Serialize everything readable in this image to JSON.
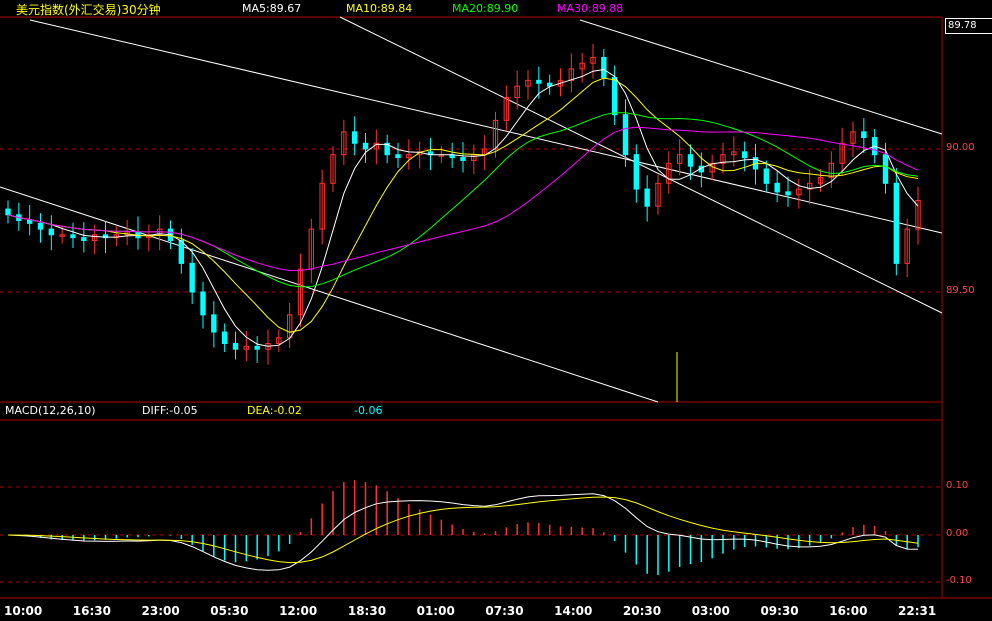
{
  "header": {
    "title": "美元指数(外汇交易)30分钟",
    "ma5": "MA5:89.67",
    "ma10": "MA10:89.84",
    "ma20": "MA20:89.90",
    "ma30": "MA30:89.88",
    "last_price": "89.78"
  },
  "macd_header": {
    "name": "MACD(12,26,10)",
    "diff": "DIFF:-0.05",
    "dea": "DEA:-0.02",
    "macd": "-0.06"
  },
  "colors": {
    "up": "#ff3030",
    "down": "#00ffff",
    "ma5": "#ffffff",
    "ma10": "#ffff00",
    "ma20": "#00ff00",
    "ma30": "#ff00ff",
    "grid": "#b00000"
  },
  "chart_data": [
    {
      "type": "candlestick",
      "title": "美元指数(外汇交易)30分钟",
      "y_ticks": [
        "90.00",
        "89.50"
      ],
      "x_ticks": [
        "10:00",
        "16:30",
        "23:00",
        "05:30",
        "12:00",
        "18:30",
        "01:00",
        "07:30",
        "14:00",
        "20:30",
        "03:00",
        "09:30",
        "16:00",
        "22:31"
      ],
      "series": [
        {
          "name": "MA5",
          "value": 89.67
        },
        {
          "name": "MA10",
          "value": 89.84
        },
        {
          "name": "MA20",
          "value": 89.9
        },
        {
          "name": "MA30",
          "value": 89.88
        }
      ],
      "closes": [
        89.77,
        89.75,
        89.74,
        89.72,
        89.7,
        89.7,
        89.69,
        89.68,
        89.7,
        89.69,
        89.7,
        89.71,
        89.69,
        89.7,
        89.72,
        89.68,
        89.6,
        89.5,
        89.42,
        89.36,
        89.32,
        89.3,
        89.31,
        89.3,
        89.32,
        89.34,
        89.42,
        89.58,
        89.72,
        89.88,
        89.98,
        90.06,
        90.02,
        90.0,
        90.02,
        89.98,
        89.97,
        89.98,
        89.99,
        89.98,
        89.98,
        89.97,
        89.96,
        89.98,
        90.0,
        90.1,
        90.18,
        90.22,
        90.24,
        90.23,
        90.22,
        90.24,
        90.28,
        90.3,
        90.32,
        90.25,
        90.12,
        89.98,
        89.86,
        89.8,
        89.88,
        89.95,
        89.98,
        89.94,
        89.92,
        89.95,
        89.98,
        89.99,
        89.97,
        89.93,
        89.88,
        89.85,
        89.84,
        89.86,
        89.88,
        89.9,
        89.95,
        90.02,
        90.06,
        90.04,
        89.98,
        89.88,
        89.6,
        89.72,
        89.82
      ]
    },
    {
      "type": "bar+line",
      "title": "MACD(12,26,10)",
      "y_ticks": [
        "0.10",
        "0.00",
        "-0.10"
      ],
      "series": [
        {
          "name": "DIFF",
          "value": -0.05
        },
        {
          "name": "DEA",
          "value": -0.02
        },
        {
          "name": "MACD",
          "value": -0.06
        }
      ]
    }
  ]
}
